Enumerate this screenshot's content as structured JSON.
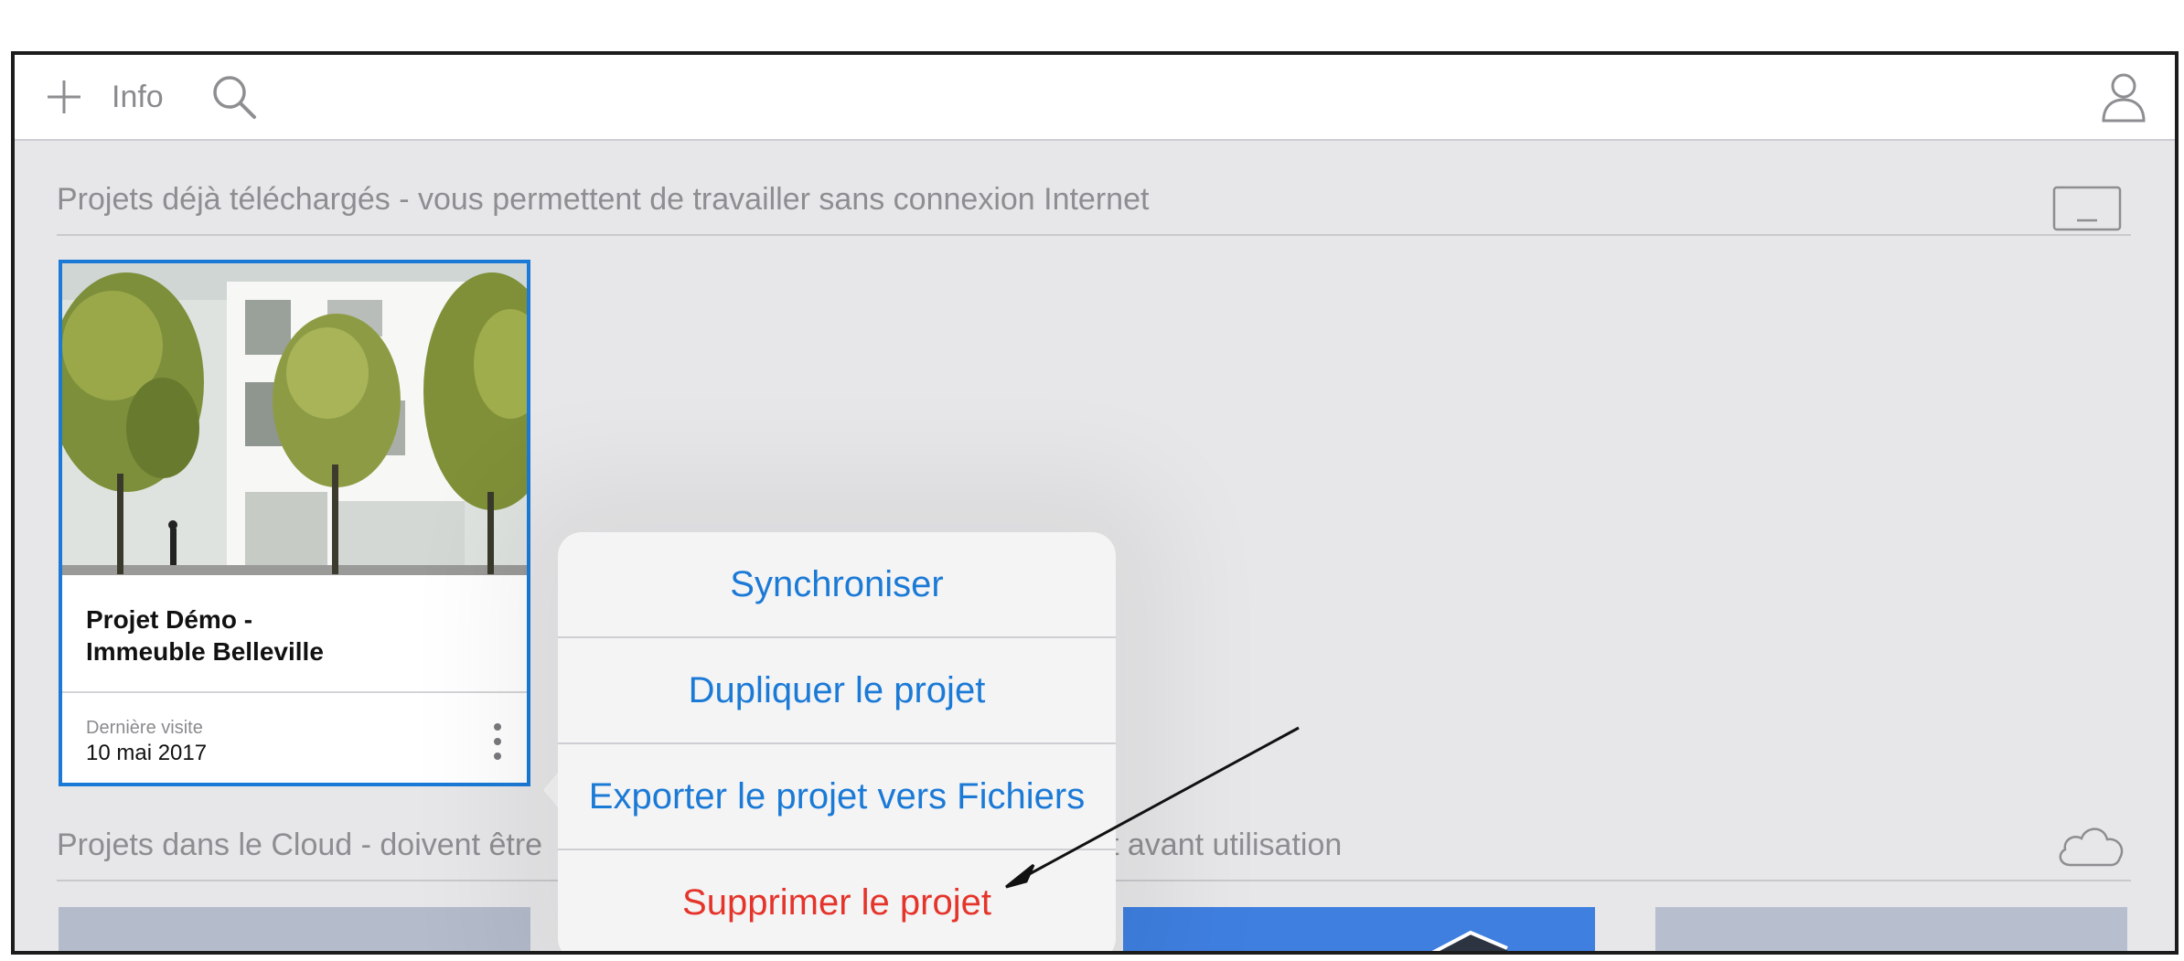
{
  "toolbar": {
    "info_label": "Info",
    "icons": {
      "add": "plus-icon",
      "search": "search-icon",
      "account": "user-icon"
    }
  },
  "sections": {
    "downloaded_title": "Projets déjà téléchargés - vous permettent de travailler sans connexion Internet",
    "cloud_title_left": "Projets dans le Cloud - doivent être",
    "cloud_title_right": "t avant utilisation",
    "downloaded_icon": "laptop-icon",
    "cloud_icon": "cloud-icon"
  },
  "project_card": {
    "title_line1": "Projet Démo -",
    "title_line2": "Immeuble Belleville",
    "last_visit_label": "Dernière visite",
    "last_visit_value": "10 mai 2017",
    "selected": true
  },
  "context_menu": {
    "items": [
      {
        "label": "Synchroniser",
        "style": "default"
      },
      {
        "label": "Dupliquer le projet",
        "style": "default"
      },
      {
        "label": "Exporter le projet vers Fichiers",
        "style": "default"
      },
      {
        "label": "Supprimer le projet",
        "style": "destructive"
      }
    ]
  },
  "colors": {
    "accent": "#1b7ad6",
    "destructive": "#e5342a",
    "background": "#e7e7e9",
    "secondary_text": "#8e8e92"
  }
}
